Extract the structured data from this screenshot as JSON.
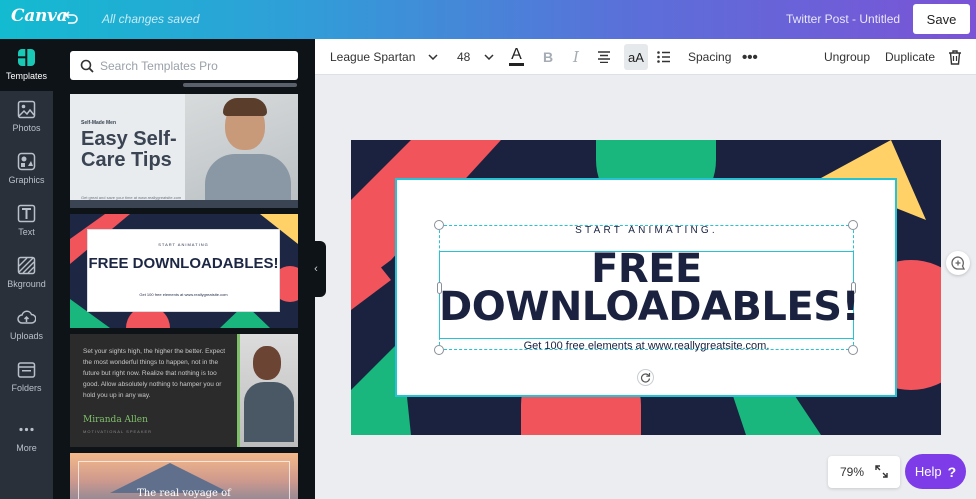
{
  "app": {
    "logo": "Canva",
    "save_status": "All changes saved",
    "doc_title": "Twitter Post - Untitled",
    "save_label": "Save"
  },
  "rail": {
    "items": [
      {
        "label": "Templates",
        "icon": "templates-icon"
      },
      {
        "label": "Photos",
        "icon": "photos-icon"
      },
      {
        "label": "Graphics",
        "icon": "graphics-icon"
      },
      {
        "label": "Text",
        "icon": "text-icon"
      },
      {
        "label": "Bkground",
        "icon": "background-icon"
      },
      {
        "label": "Uploads",
        "icon": "uploads-icon"
      },
      {
        "label": "Folders",
        "icon": "folders-icon"
      },
      {
        "label": "More",
        "icon": "more-icon"
      }
    ]
  },
  "panel": {
    "search_placeholder": "Search Templates Pro",
    "templates": [
      {
        "small": "Self-Made Men",
        "title": "Easy Self-Care Tips",
        "footer": "Get great and save your time at www.reallygreatsite.com"
      },
      {
        "kicker": "START ANIMATING",
        "title": "FREE DOWNLOADABLES!",
        "sub": "Get 100 free elements at www.reallygreatsite.com"
      },
      {
        "body": "Set your sights high, the higher the better. Expect the most wonderful things to happen, not in the future but right now. Realize that nothing is too good. Allow absolutely nothing to hamper you or hold you up in any way.",
        "name": "Miranda Allen",
        "role": "MOTIVATIONAL SPEAKER"
      },
      {
        "title": "The real voyage of"
      }
    ]
  },
  "toolbar": {
    "font": "League Spartan",
    "size": "48",
    "color_glyph": "A",
    "bold": "B",
    "italic": "I",
    "case": "aA",
    "spacing": "Spacing",
    "more": "•••",
    "ungroup": "Ungroup",
    "duplicate": "Duplicate"
  },
  "design": {
    "kicker": "START ANIMATING.",
    "headline_1": "FREE",
    "headline_2": "DOWNLOADABLES!",
    "sub": "Get 100 free elements at www.reallygreatsite.com.",
    "colors": {
      "navy": "#1a2240",
      "red": "#f2545b",
      "green": "#19b77d",
      "yellow": "#ffd166",
      "selection": "#25c3d3"
    }
  },
  "footer": {
    "zoom": "79%",
    "help": "Help",
    "help_mark": "?"
  }
}
